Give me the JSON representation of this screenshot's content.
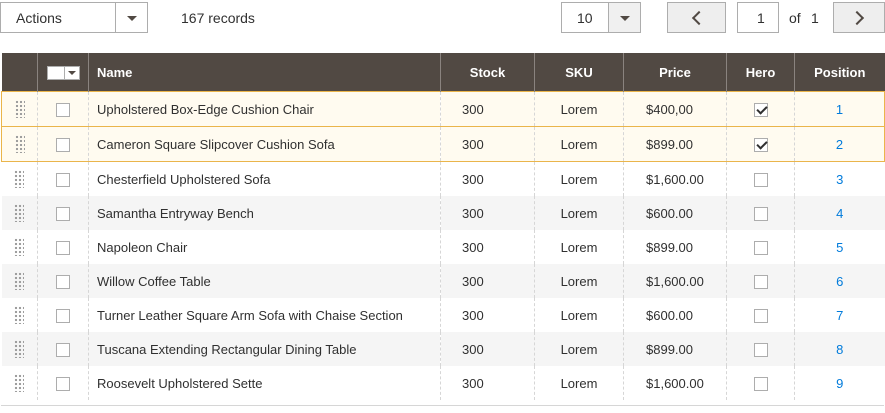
{
  "toolbar": {
    "actions_label": "Actions",
    "records_text": "167 records",
    "per_page_value": "10",
    "page_value": "1",
    "of_label": "of",
    "total_pages": "1"
  },
  "icons": {
    "dropdown": "chevron-down-icon",
    "prev": "chevron-left-icon",
    "next": "chevron-right-icon",
    "drag": "drag-handle-icon",
    "check": "checkmark-icon"
  },
  "colors": {
    "header_bg": "#514943",
    "header_text": "#ffffff",
    "position_link": "#007bdb",
    "selected_border": "#eab54b"
  },
  "table": {
    "headers": [
      "Name",
      "Stock",
      "SKU",
      "Price",
      "Hero",
      "Position"
    ],
    "rows": [
      {
        "name": "Upholstered Box-Edge Cushion Chair",
        "stock": "300",
        "sku": "Lorem",
        "price": "$400,00",
        "hero": true,
        "position": "1",
        "selected": false
      },
      {
        "name": "Cameron Square Slipcover Cushion Sofa",
        "stock": "300",
        "sku": "Lorem",
        "price": "$899.00",
        "hero": true,
        "position": "2",
        "selected": false
      },
      {
        "name": "Chesterfield Upholstered Sofa",
        "stock": "300",
        "sku": "Lorem",
        "price": "$1,600.00",
        "hero": false,
        "position": "3",
        "selected": false
      },
      {
        "name": "Samantha Entryway Bench",
        "stock": "300",
        "sku": "Lorem",
        "price": "$600.00",
        "hero": false,
        "position": "4",
        "selected": false
      },
      {
        "name": "Napoleon Chair",
        "stock": "300",
        "sku": "Lorem",
        "price": "$899.00",
        "hero": false,
        "position": "5",
        "selected": false
      },
      {
        "name": "Willow Coffee Table",
        "stock": "300",
        "sku": "Lorem",
        "price": "$1,600.00",
        "hero": false,
        "position": "6",
        "selected": false
      },
      {
        "name": "Turner Leather Square Arm Sofa with Chaise Section",
        "stock": "300",
        "sku": "Lorem",
        "price": "$600.00",
        "hero": false,
        "position": "7",
        "selected": false
      },
      {
        "name": "Tuscana Extending Rectangular Dining Table",
        "stock": "300",
        "sku": "Lorem",
        "price": "$899.00",
        "hero": false,
        "position": "8",
        "selected": false
      },
      {
        "name": "Roosevelt Upholstered Sette",
        "stock": "300",
        "sku": "Lorem",
        "price": "$1,600.00",
        "hero": false,
        "position": "9",
        "selected": false
      }
    ]
  }
}
